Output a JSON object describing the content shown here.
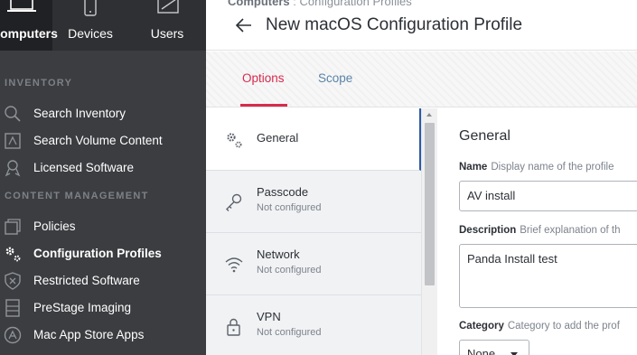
{
  "topnav": {
    "tabs": [
      {
        "label": "Computers",
        "icon": "laptop-icon",
        "active": true
      },
      {
        "label": "Devices",
        "icon": "mobile-device-icon",
        "active": false
      },
      {
        "label": "Users",
        "icon": "users-icon",
        "active": false
      }
    ]
  },
  "sidebar": {
    "inventory_heading": "INVENTORY",
    "inventory_items": [
      {
        "label": "Search Inventory",
        "icon": "search-icon"
      },
      {
        "label": "Search Volume Content",
        "icon": "volume-content-icon"
      },
      {
        "label": "Licensed Software",
        "icon": "license-ribbon-icon"
      }
    ],
    "content_heading": "CONTENT MANAGEMENT",
    "content_items": [
      {
        "label": "Policies",
        "icon": "policies-icon"
      },
      {
        "label": "Configuration Profiles",
        "icon": "gears-icon",
        "active": true
      },
      {
        "label": "Restricted Software",
        "icon": "shield-x-icon"
      },
      {
        "label": "PreStage Imaging",
        "icon": "imaging-icon"
      },
      {
        "label": "Mac App Store Apps",
        "icon": "app-store-icon"
      }
    ]
  },
  "header": {
    "breadcrumb_root": "Computers",
    "breadcrumb_sep": ":",
    "breadcrumb_leaf": "Configuration Profiles",
    "title": "New macOS Configuration Profile"
  },
  "profile_tabs": {
    "options": "Options",
    "scope": "Scope",
    "active": "Options"
  },
  "payloads": [
    {
      "name": "General",
      "status": "",
      "icon": "gears-icon"
    },
    {
      "name": "Passcode",
      "status": "Not configured",
      "icon": "key-icon"
    },
    {
      "name": "Network",
      "status": "Not configured",
      "icon": "wifi-icon"
    },
    {
      "name": "VPN",
      "status": "Not configured",
      "icon": "lock-icon"
    }
  ],
  "form": {
    "section_title": "General",
    "name_label": "Name",
    "name_hint": "Display name of the profile",
    "name_value": "AV install",
    "description_label": "Description",
    "description_hint": "Brief explanation of th",
    "description_value": "Panda Install test",
    "category_label": "Category",
    "category_hint": "Category to add the prof",
    "category_value": "None"
  },
  "colors": {
    "accent": "#d72b4c",
    "link": "#5b84a8",
    "sidebar_bg": "#3b3d40",
    "topnav_bg": "#2e3033",
    "selection_bar": "#2b5aa6"
  }
}
